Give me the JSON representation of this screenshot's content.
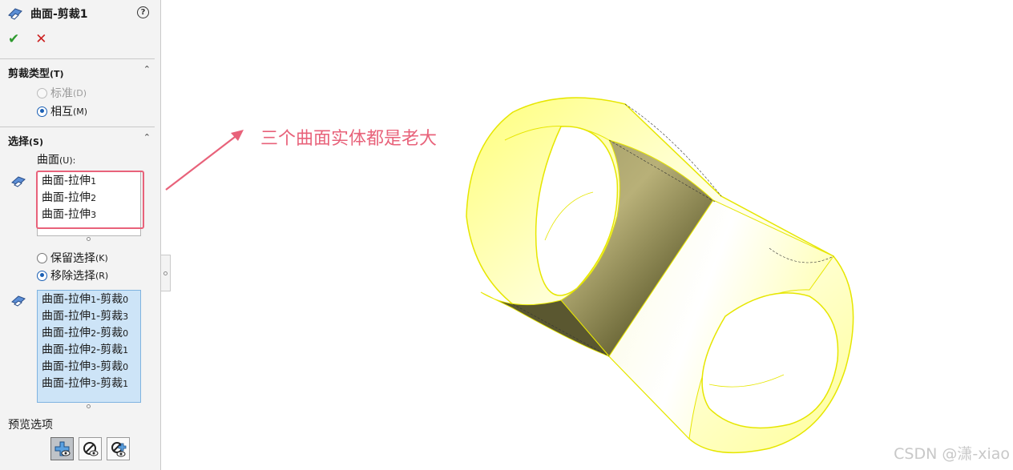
{
  "panel": {
    "title": "曲面-剪裁1",
    "help_symbol": "?",
    "ok_symbol": "✔",
    "cancel_symbol": "✕",
    "trim_type": {
      "header": "剪裁类型",
      "header_key": "(T)",
      "collapse_symbol": "⌃",
      "options": [
        {
          "label": "标准",
          "key": "(D)",
          "state": "disabled"
        },
        {
          "label": "相互",
          "key": "(M)",
          "state": "selected"
        }
      ]
    },
    "selection": {
      "header": "选择",
      "header_key": "(S)",
      "collapse_symbol": "⌃",
      "surfaces_label": "曲面",
      "surfaces_key": "(U):",
      "surfaces": [
        {
          "name": "曲面-拉伸",
          "num": "1"
        },
        {
          "name": "曲面-拉伸",
          "num": "2"
        },
        {
          "name": "曲面-拉伸",
          "num": "3"
        }
      ],
      "options": [
        {
          "label": "保留选择",
          "key": "(K)",
          "state": "off"
        },
        {
          "label": "移除选择",
          "key": "(R)",
          "state": "selected"
        }
      ],
      "pieces": [
        {
          "a": "曲面-拉伸",
          "an": "1",
          "b": "-剪裁",
          "bn": "0"
        },
        {
          "a": "曲面-拉伸",
          "an": "1",
          "b": "-剪裁",
          "bn": "3"
        },
        {
          "a": "曲面-拉伸",
          "an": "2",
          "b": "-剪裁",
          "bn": "0"
        },
        {
          "a": "曲面-拉伸",
          "an": "2",
          "b": "-剪裁",
          "bn": "1"
        },
        {
          "a": "曲面-拉伸",
          "an": "3",
          "b": "-剪裁",
          "bn": "0"
        },
        {
          "a": "曲面-拉伸",
          "an": "3",
          "b": "-剪裁",
          "bn": "1"
        }
      ]
    },
    "preview": {
      "label": "预览选项"
    }
  },
  "viewport": {
    "annotation": "三个曲面实体都是老大",
    "watermark": "CSDN @潇-xiao",
    "colors": {
      "annotation": "#e8627a",
      "surface": "#ffff9c",
      "edge": "#e6e600"
    }
  },
  "icons": [
    "trim-feature-icon",
    "help-icon",
    "ok-icon",
    "cancel-icon",
    "chevron-up-icon",
    "surface-select-icon",
    "pieces-select-icon",
    "include-preview-icon",
    "hide-preview-icon",
    "show-preview-icon"
  ]
}
